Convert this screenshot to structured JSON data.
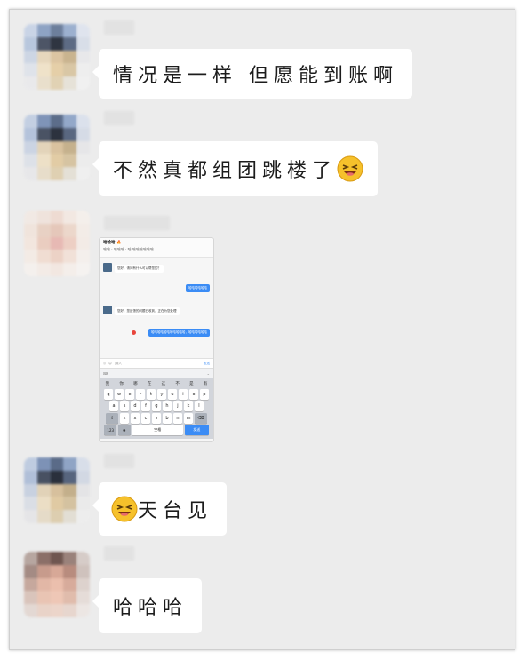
{
  "messages": [
    {
      "text": "情况是一样 但愿能到账啊"
    },
    {
      "text": "不然真都组团跳楼了",
      "emoji": "grinning-squint-face"
    },
    {
      "type": "image",
      "screenshot": {
        "title": "哈哈哈 🔥",
        "subtitle": "哈哈 · 哈哈哈 · 哈 哈哈哈哈哈哈",
        "incoming_1": "您好，请问有什么可以帮您的？",
        "outgoing_1": "哈哈哈哈哈哈",
        "incoming_2": "您好，您反馈的问题已收到，正在为您处理",
        "outgoing_2": "哈哈哈哈哈哈哈哈哈哈哈，哈哈哈哈哈哈",
        "input_placeholder": "|输入",
        "send_label": "发送",
        "candidates_top": [
          "我",
          "你",
          "哪",
          "在",
          "这",
          "不",
          "是",
          "有"
        ],
        "row1": [
          "q",
          "w",
          "e",
          "r",
          "t",
          "y",
          "u",
          "i",
          "o",
          "p"
        ],
        "row2": [
          "a",
          "s",
          "d",
          "f",
          "g",
          "h",
          "j",
          "k",
          "l"
        ],
        "row3": [
          "z",
          "x",
          "c",
          "v",
          "b",
          "n",
          "m"
        ],
        "numbers_key": "123",
        "space_label": "空格",
        "go_label": "发送"
      }
    },
    {
      "text": "天台见",
      "emoji": "grinning-squint-face"
    },
    {
      "text": "哈哈哈"
    }
  ]
}
